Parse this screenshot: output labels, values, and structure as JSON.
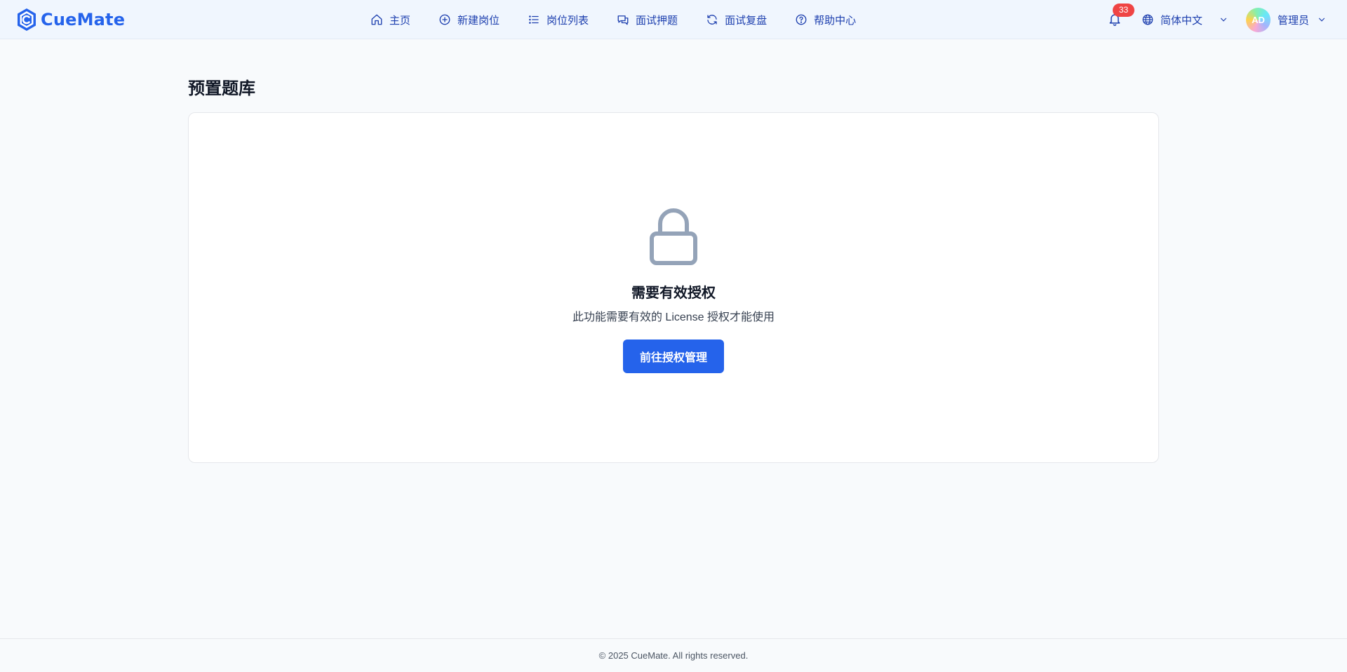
{
  "app": {
    "name": "CueMate",
    "accent": "#2563eb"
  },
  "nav": {
    "items": [
      {
        "label": "主页",
        "icon": "home-icon"
      },
      {
        "label": "新建岗位",
        "icon": "plus-circle-icon"
      },
      {
        "label": "岗位列表",
        "icon": "list-icon"
      },
      {
        "label": "面试押题",
        "icon": "chat-icon"
      },
      {
        "label": "面试复盘",
        "icon": "refresh-icon"
      },
      {
        "label": "帮助中心",
        "icon": "help-circle-icon"
      }
    ]
  },
  "header": {
    "notifications": {
      "count": "33",
      "icon": "bell-icon"
    },
    "language": {
      "label": "简体中文",
      "icon": "globe-icon"
    },
    "user": {
      "initials": "AD",
      "name": "管理员"
    }
  },
  "page": {
    "title": "预置题库"
  },
  "license_gate": {
    "icon": "lock-icon",
    "title": "需要有效授权",
    "description": "此功能需要有效的 License 授权才能使用",
    "button_label": "前往授权管理"
  },
  "footer": {
    "text": "© 2025 CueMate. All rights reserved."
  }
}
